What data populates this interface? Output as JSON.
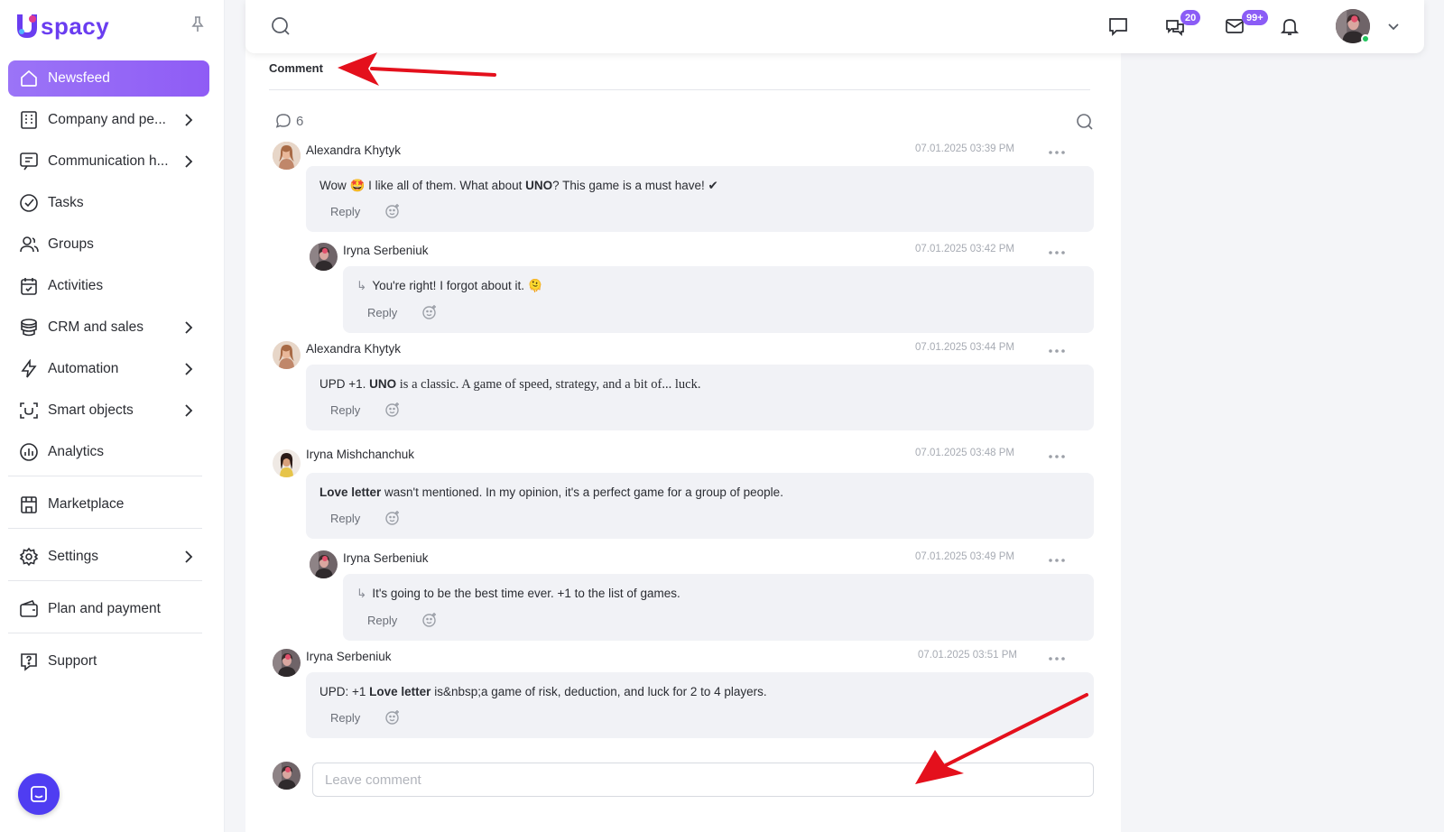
{
  "app": {
    "logo_text": "spacy",
    "brand_color": "#8b5cf6"
  },
  "sidebar": {
    "items": [
      {
        "label": "Newsfeed",
        "icon": "home-icon",
        "active": true
      },
      {
        "label": "Company and pe...",
        "icon": "building-icon",
        "chevron": true
      },
      {
        "label": "Communication h...",
        "icon": "communication-icon",
        "chevron": true
      },
      {
        "label": "Tasks",
        "icon": "check-circle-icon"
      },
      {
        "label": "Groups",
        "icon": "users-icon"
      },
      {
        "label": "Activities",
        "icon": "calendar-icon"
      },
      {
        "label": "CRM and sales",
        "icon": "coins-icon",
        "chevron": true
      },
      {
        "label": "Automation",
        "icon": "lightning-icon",
        "chevron": true
      },
      {
        "label": "Smart objects",
        "icon": "scan-icon",
        "chevron": true
      },
      {
        "label": "Analytics",
        "icon": "chart-icon"
      },
      {
        "label": "Marketplace",
        "icon": "store-icon"
      },
      {
        "label": "Settings",
        "icon": "gear-icon",
        "chevron": true
      },
      {
        "label": "Plan and payment",
        "icon": "wallet-icon"
      },
      {
        "label": "Support",
        "icon": "question-icon"
      }
    ]
  },
  "topbar": {
    "chat_badge": "20",
    "mail_badge": "99+"
  },
  "panel": {
    "title": "Comment",
    "comment_count": "6",
    "reply_label": "Reply",
    "input_placeholder": "Leave comment"
  },
  "comments": [
    {
      "author": "Alexandra Khytyk",
      "time": "07.01.2025 03:39 PM",
      "text_a": "Wow 🤩 I like all of them. What about ",
      "text_bold": "UNO",
      "text_b": "? This game is a must have! ✔"
    },
    {
      "author": "Iryna Serbeniuk",
      "time": "07.01.2025 03:42 PM",
      "text": "You're right! I forgot about it. 🫠"
    },
    {
      "author": "Alexandra Khytyk",
      "time": "07.01.2025 03:44 PM",
      "text_a": "UPD +1. ",
      "text_bold": "UNO",
      "text_b": " is a classic. A game of speed, strategy, and a bit of... luck."
    },
    {
      "author": "Iryna Mishchanchuk",
      "time": "07.01.2025 03:48 PM",
      "text_bold": "Love letter",
      "text_b": " wasn't mentioned. In my opinion, it's a perfect game for a group of people."
    },
    {
      "author": "Iryna Serbeniuk",
      "time": "07.01.2025 03:49 PM",
      "text": "It's going to be the best time ever. +1 to the list of games."
    },
    {
      "author": "Iryna Serbeniuk",
      "time": "07.01.2025 03:51 PM",
      "text_a": "UPD: +1 ",
      "text_bold": "Love letter",
      "text_b": " is&nbsp;a game of risk, deduction, and luck for 2 to 4 players."
    }
  ]
}
